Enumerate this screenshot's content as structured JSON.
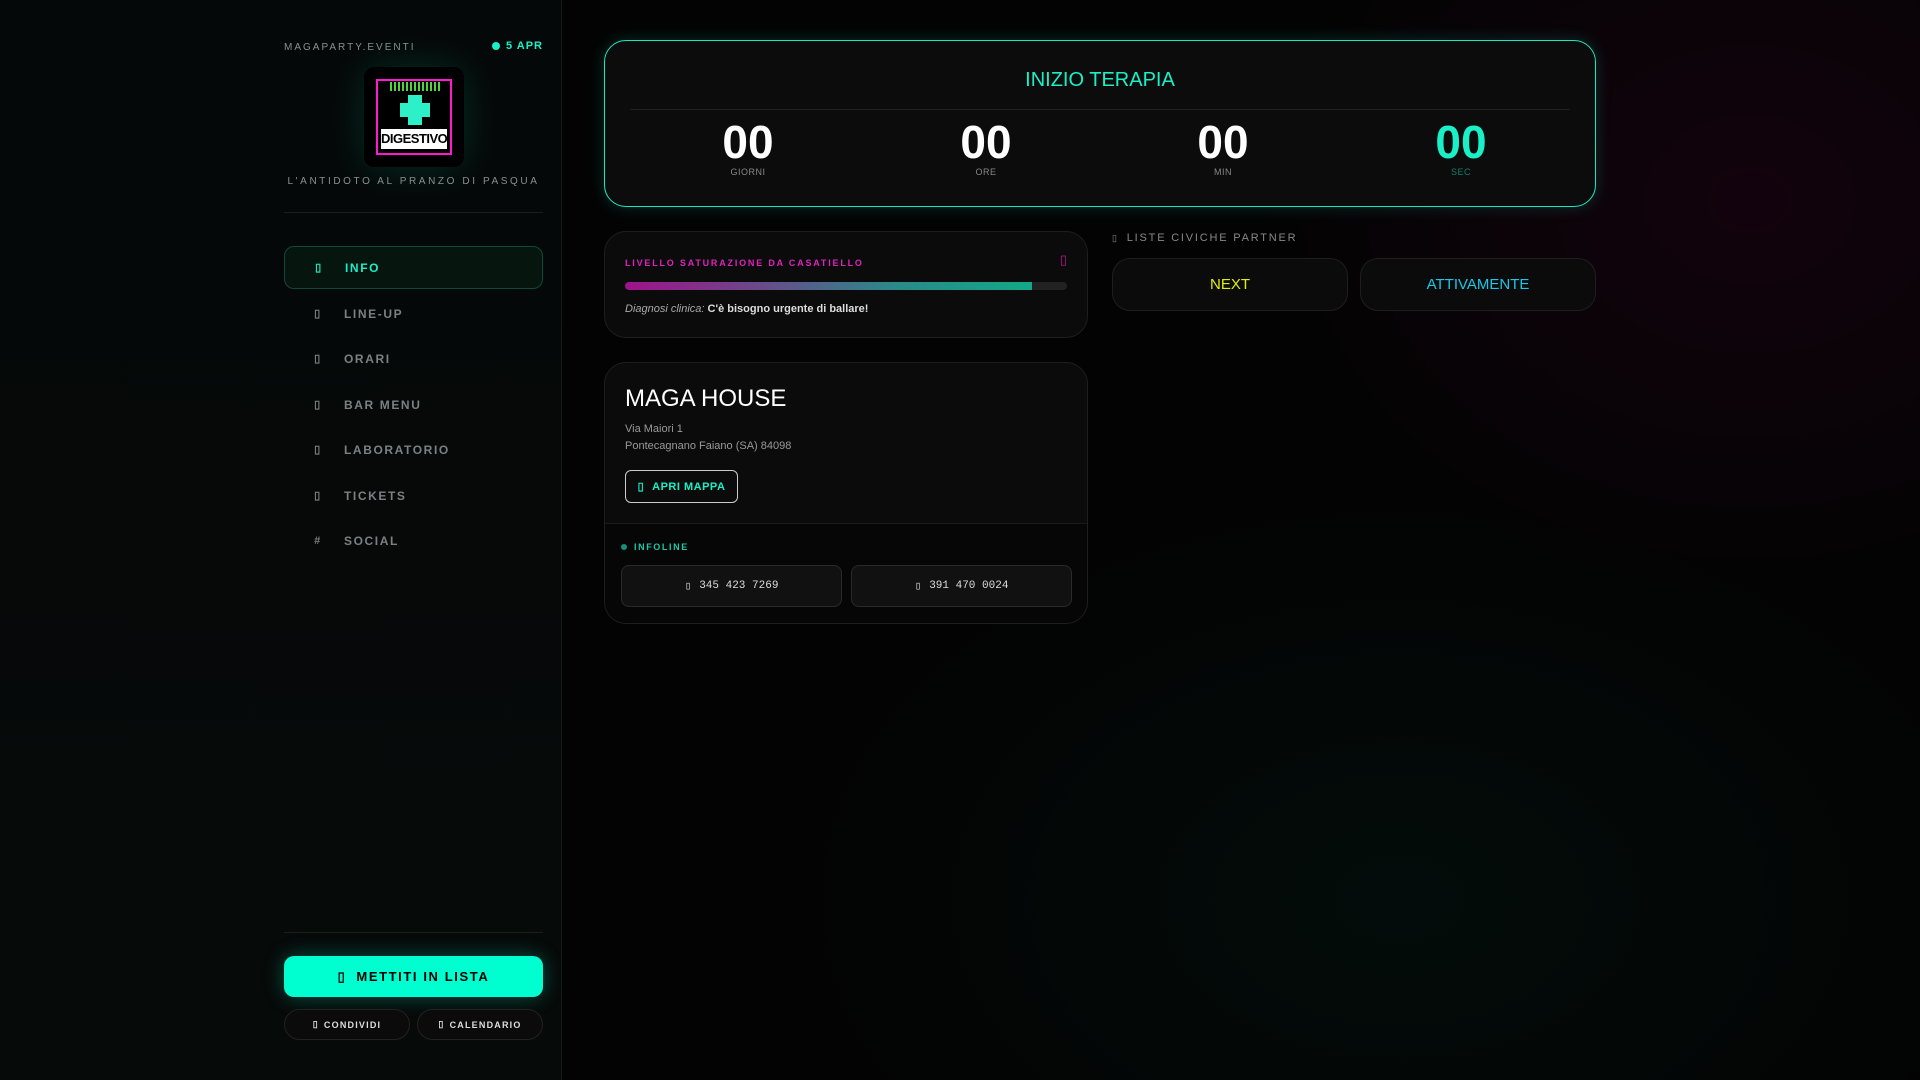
{
  "sidebar": {
    "brand": "MAGAPARTY.EVENTI",
    "date": "5 APR",
    "logo_text": "DIGESTIVO",
    "logo_top_text": "MAGAPARTY",
    "tagline": "L'ANTIDOTO AL PRANZO DI PASQUA",
    "nav": [
      {
        "label": "INFO",
        "icon": "info-icon",
        "glyph": "▯"
      },
      {
        "label": "LINE-UP",
        "icon": "music-icon",
        "glyph": "▯"
      },
      {
        "label": "ORARI",
        "icon": "clock-icon",
        "glyph": "▯"
      },
      {
        "label": "BAR MENU",
        "icon": "cocktail-icon",
        "glyph": "▯"
      },
      {
        "label": "LABORATORIO",
        "icon": "flask-icon",
        "glyph": "▯"
      },
      {
        "label": "TICKETS",
        "icon": "ticket-icon",
        "glyph": "▯"
      },
      {
        "label": "SOCIAL",
        "icon": "hashtag-icon",
        "glyph": "#"
      }
    ],
    "cta": "METTITI IN LISTA",
    "share": "CONDIVIDI",
    "calendar": "CALENDARIO"
  },
  "countdown": {
    "title": "INIZIO TERAPIA",
    "units": [
      {
        "value": "00",
        "label": "GIORNI"
      },
      {
        "value": "00",
        "label": "ORE"
      },
      {
        "value": "00",
        "label": "MIN"
      },
      {
        "value": "00",
        "label": "SEC"
      }
    ]
  },
  "saturation": {
    "title": "LIVELLO SATURAZIONE DA CASATIELLO",
    "percent": 92,
    "diagnosis_label": "Diagnosi clinica:",
    "diagnosis": "C'è bisogno urgente di ballare!"
  },
  "venue": {
    "name": "MAGA HOUSE",
    "address1": "Via Maiori 1",
    "address2": "Pontecagnano Faiano (SA) 84098",
    "map_button": "APRI MAPPA",
    "infoline_label": "INFOLINE",
    "phones": [
      "345 423 7269",
      "391 470 0024"
    ]
  },
  "partners": {
    "label": "LISTE CIVICHE PARTNER",
    "items": [
      {
        "name": "NEXT",
        "color": "#e0f000"
      },
      {
        "name": "ATTIVAMENTE",
        "color": "#18c8e8"
      }
    ]
  },
  "colors": {
    "accent": "#19f0c8",
    "magenta": "#e020c0"
  }
}
